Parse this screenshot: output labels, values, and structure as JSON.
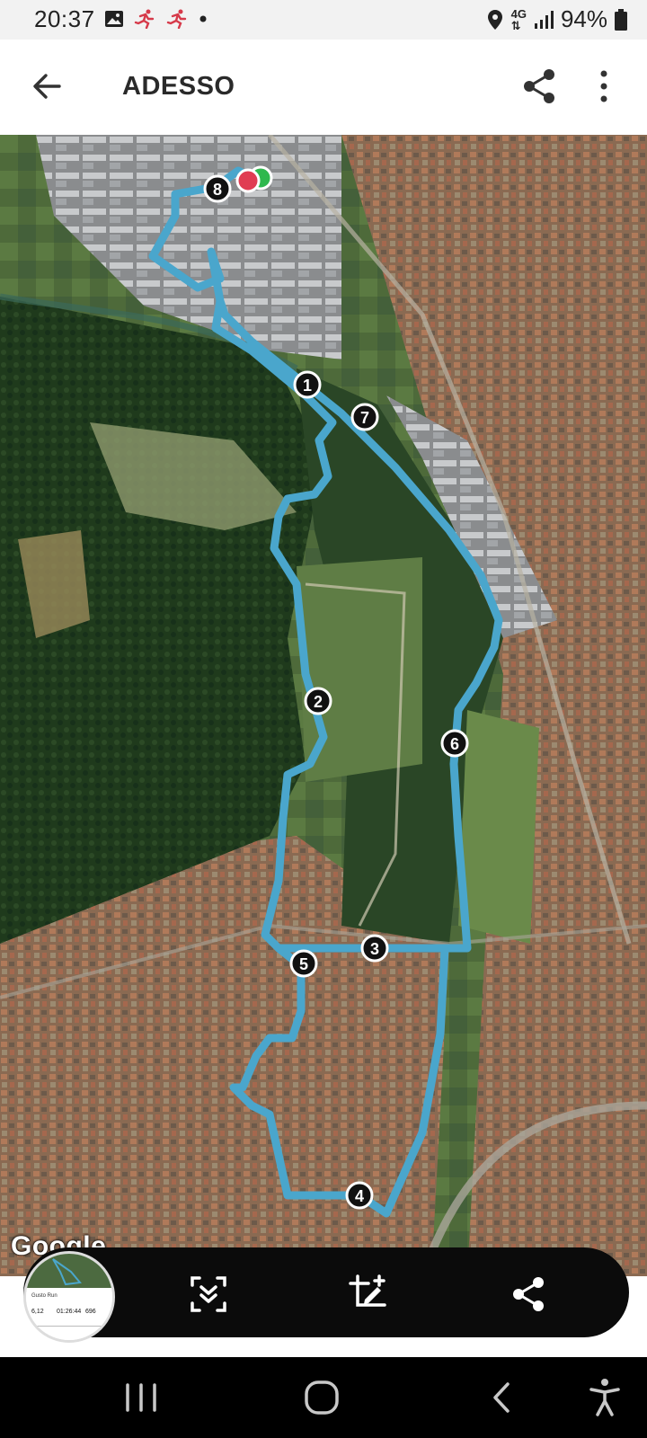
{
  "status_bar": {
    "time": "20:37",
    "network": "4G",
    "battery": "94%"
  },
  "app_bar": {
    "title": "ADESSO",
    "back_icon": "arrow-left-icon",
    "share_icon": "share-icon",
    "more_icon": "more-vert-icon"
  },
  "map": {
    "attribution": "Google",
    "markers": [
      "1",
      "2",
      "3",
      "4",
      "5",
      "6",
      "7",
      "8"
    ],
    "route_color": "#4aa6cc"
  },
  "screenshot_toolbar": {
    "thumbnail": {
      "label": "Gusto Run",
      "time": "01:26:44",
      "distance": "6,12",
      "value": "696"
    },
    "scroll_capture_icon": "scroll-capture-icon",
    "crop_edit_icon": "crop-edit-icon",
    "share_icon": "share-icon"
  },
  "nav_bar": {
    "recents_icon": "recents-icon",
    "home_icon": "home-icon",
    "back_icon": "back-icon",
    "accessibility_icon": "accessibility-icon"
  }
}
